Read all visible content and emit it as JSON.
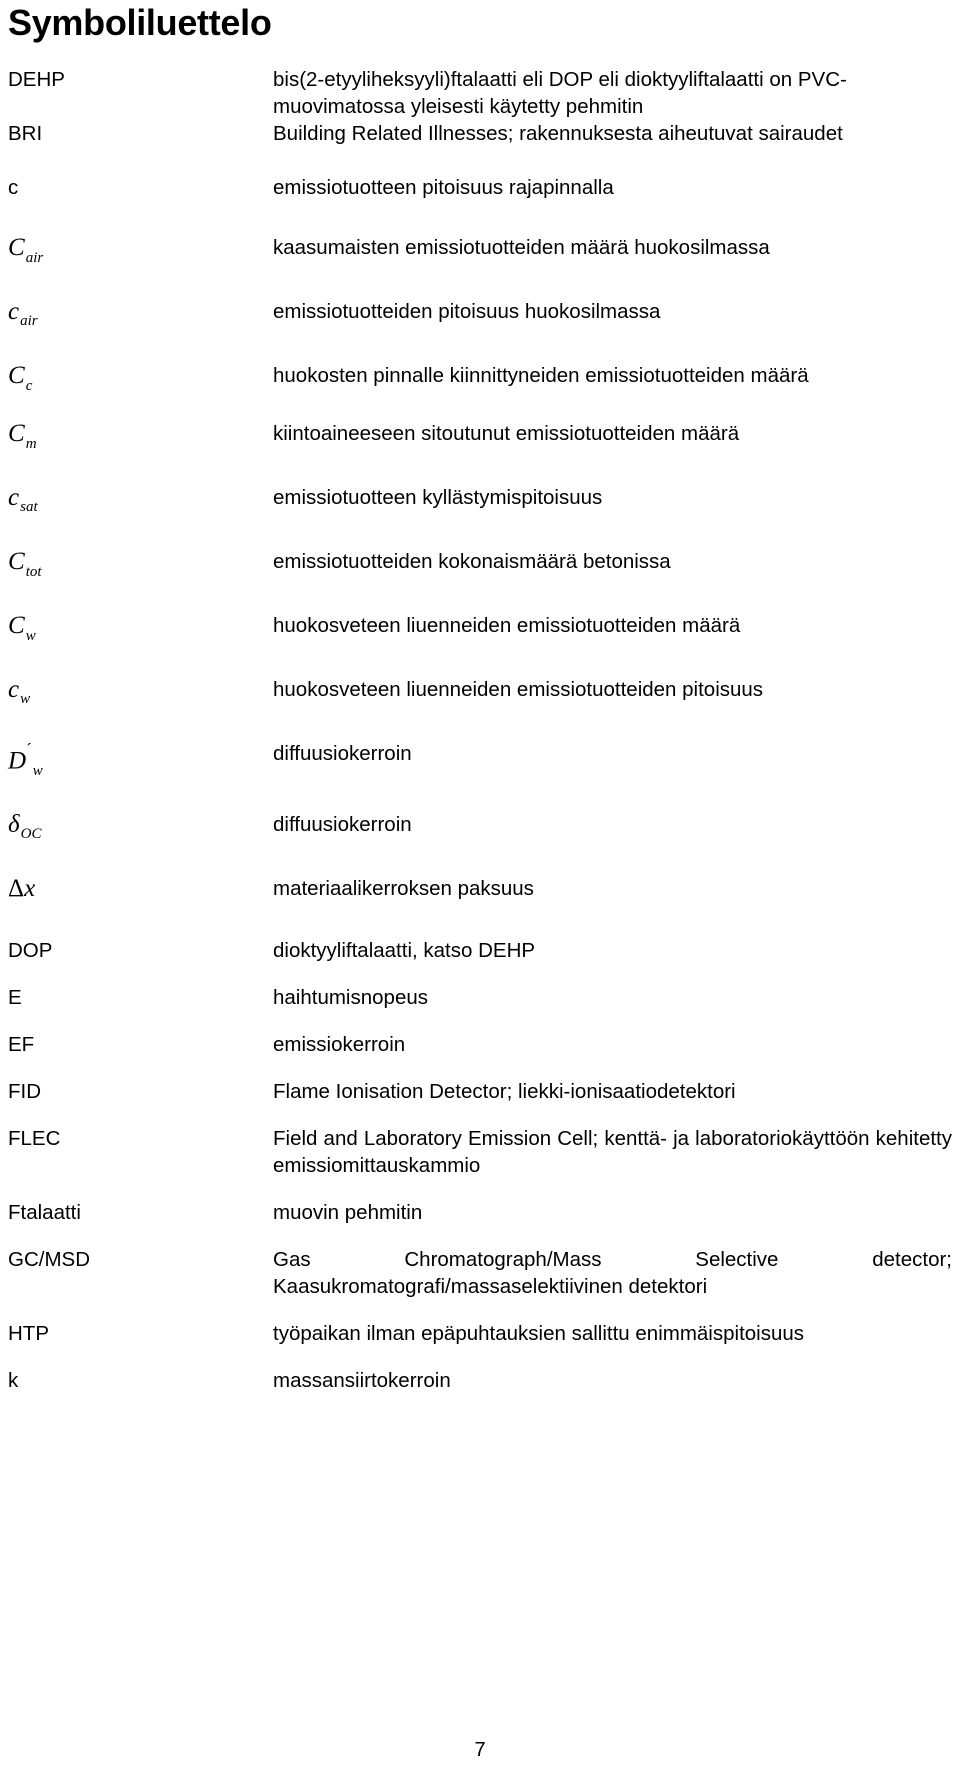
{
  "document": {
    "title": "Symboliluettelo",
    "page_number": "7"
  },
  "entries": [
    {
      "symbol": "DEHP",
      "symbol_kind": "abbr",
      "definition": "bis(2-etyyliheksyyli)ftalaatti eli DOP eli dioktyyliftalaatti on PVC- muovimatossa yleisesti käytetty pehmitin",
      "justified": false
    },
    {
      "symbol": "BRI",
      "symbol_kind": "abbr",
      "definition": "Building Related Illnesses; rakennuksesta aiheutuvat sairaudet",
      "justified": true
    },
    {
      "symbol": "c",
      "symbol_kind": "abbr",
      "definition": "emissiotuotteen pitoisuus rajapinnalla",
      "justified": false
    },
    {
      "symbol_kind": "math",
      "base": "C",
      "subscript": "air",
      "definition": "kaasumaisten emissiotuotteiden määrä huokosilmassa",
      "justified": false
    },
    {
      "symbol_kind": "math",
      "base": "c",
      "subscript": "air",
      "definition": "emissiotuotteiden pitoisuus huokosilmassa",
      "justified": false
    },
    {
      "symbol_kind": "math",
      "base": "C",
      "subscript": "c",
      "definition": "huokosten pinnalle kiinnittyneiden emissiotuotteiden määrä",
      "justified": true
    },
    {
      "symbol_kind": "math",
      "base": "C",
      "subscript": "m",
      "definition": "kiintoaineeseen sitoutunut emissiotuotteiden määrä",
      "justified": false
    },
    {
      "symbol_kind": "math",
      "base": "c",
      "subscript": "sat",
      "definition": "emissiotuotteen kyllästymispitoisuus",
      "justified": false
    },
    {
      "symbol_kind": "math",
      "base": "C",
      "subscript": "tot",
      "definition": "emissiotuotteiden kokonaismäärä betonissa",
      "justified": false
    },
    {
      "symbol_kind": "math",
      "base": "C",
      "subscript": "w",
      "definition": "huokosveteen liuenneiden emissiotuotteiden määrä",
      "justified": false
    },
    {
      "symbol_kind": "math",
      "base": "c",
      "subscript": "w",
      "definition": "huokosveteen liuenneiden emissiotuotteiden pitoisuus",
      "justified": false
    },
    {
      "symbol_kind": "math-prime",
      "base": "D",
      "prime": "´",
      "subscript": "w",
      "definition": "diffuusiokerroin",
      "justified": false
    },
    {
      "symbol_kind": "math-greek",
      "base": "δ",
      "subscript": "OC",
      "definition": "diffuusiokerroin",
      "justified": false
    },
    {
      "symbol_kind": "math-delta",
      "base": "Δ",
      "italic_tail": "x",
      "definition": "materiaalikerroksen paksuus",
      "justified": false
    },
    {
      "symbol": "DOP",
      "symbol_kind": "abbr",
      "definition": "dioktyyliftalaatti, katso DEHP",
      "justified": false
    },
    {
      "symbol": "E",
      "symbol_kind": "abbr",
      "definition": "haihtumisnopeus",
      "justified": false
    },
    {
      "symbol": "EF",
      "symbol_kind": "abbr",
      "definition": "emissiokerroin",
      "justified": false
    },
    {
      "symbol": "FID",
      "symbol_kind": "abbr",
      "definition": "Flame Ionisation Detector; liekki-ionisaatiodetektori",
      "justified": false
    },
    {
      "symbol": "FLEC",
      "symbol_kind": "abbr",
      "definition": "Field and Laboratory Emission Cell; kenttä- ja laboratoriokäyttöön kehitetty emissiomittauskammio",
      "justified": true
    },
    {
      "symbol": "Ftalaatti",
      "symbol_kind": "abbr",
      "definition": "muovin pehmitin",
      "justified": false
    },
    {
      "symbol": "GC/MSD",
      "symbol_kind": "abbr",
      "definition": "Gas Chromatograph/Mass Selective detector; Kaasukromatografi/massaselektiivinen detektori",
      "justified": true
    },
    {
      "symbol": "HTP",
      "symbol_kind": "abbr",
      "definition": "työpaikan ilman epäpuhtauksien sallittu enimmäispitoisuus",
      "justified": true
    },
    {
      "symbol": "k",
      "symbol_kind": "abbr",
      "definition": "massansiirtokerroin",
      "justified": false
    }
  ]
}
